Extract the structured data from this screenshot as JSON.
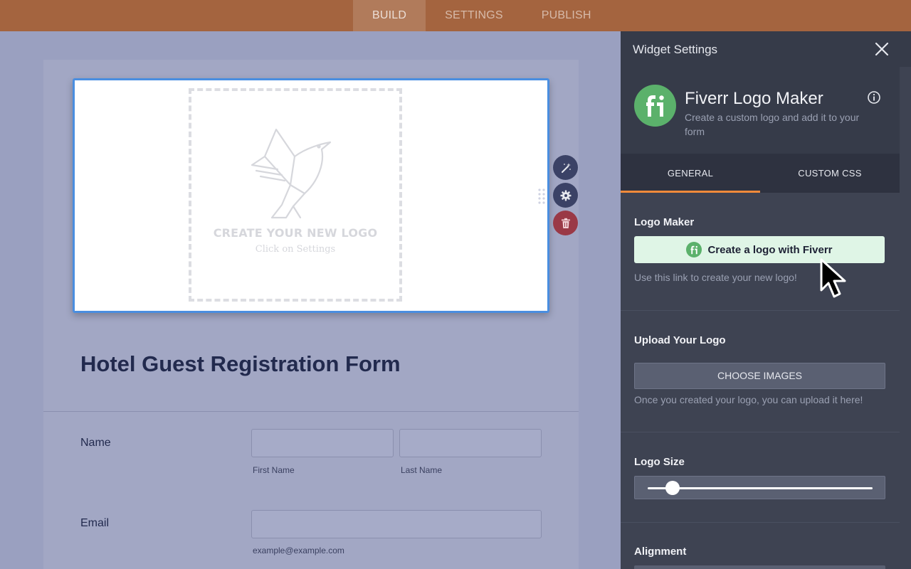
{
  "topnav": {
    "tabs": [
      {
        "label": "BUILD",
        "active": true
      },
      {
        "label": "SETTINGS",
        "active": false
      },
      {
        "label": "PUBLISH",
        "active": false
      }
    ]
  },
  "form": {
    "logo_placeholder": {
      "title": "CREATE YOUR NEW LOGO",
      "subtitle": "Click on Settings"
    },
    "title": "Hotel Guest Registration Form",
    "fields": {
      "name": {
        "label": "Name",
        "first_sublabel": "First Name",
        "last_sublabel": "Last Name"
      },
      "email": {
        "label": "Email",
        "sublabel": "example@example.com"
      }
    }
  },
  "panel": {
    "header_title": "Widget Settings",
    "widget": {
      "name": "Fiverr Logo Maker",
      "description": "Create a custom logo and add it to your form"
    },
    "tabs": [
      {
        "label": "GENERAL",
        "active": true
      },
      {
        "label": "CUSTOM CSS",
        "active": false
      }
    ],
    "logo_maker": {
      "label": "Logo Maker",
      "button_label": "Create a logo with Fiverr",
      "hint": "Use this link to create your new logo!"
    },
    "upload": {
      "label": "Upload Your Logo",
      "button_label": "CHOOSE IMAGES",
      "hint": "Once you created your logo, you can upload it here!"
    },
    "logo_size": {
      "label": "Logo Size",
      "value_fraction": 0.11
    },
    "alignment": {
      "label": "Alignment"
    }
  },
  "colors": {
    "topbar": "#a4643f",
    "accent_tab_underline": "#f28a3a",
    "fiverr_green": "#5bb16b",
    "widget_border": "#4a8ee0",
    "delete_button": "#9a3946"
  },
  "icons": [
    "magic-wand-icon",
    "gear-icon",
    "trash-icon",
    "drag-handle-icon",
    "close-icon",
    "info-icon",
    "fiverr-logo-icon",
    "bird-logo-icon",
    "mouse-cursor-icon"
  ]
}
